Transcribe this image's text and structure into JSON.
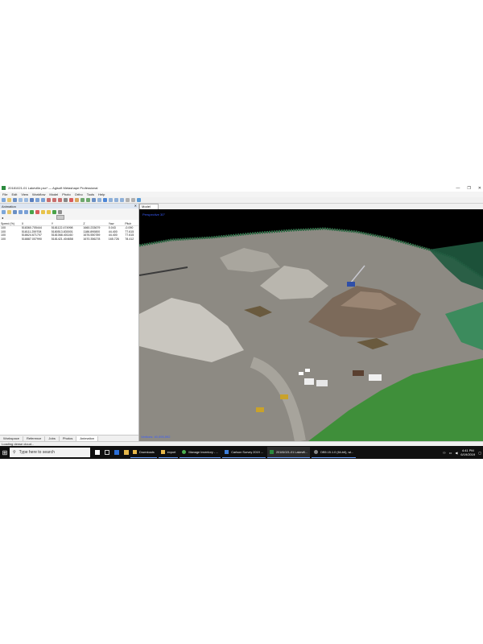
{
  "window": {
    "title": "20181021-01 Lakeville.psx* — Agisoft Metashape Professional",
    "controls": [
      "—",
      "❐",
      "✕"
    ]
  },
  "menu": [
    "File",
    "Edit",
    "View",
    "Workflow",
    "Model",
    "Photo",
    "Ortho",
    "Tools",
    "Help"
  ],
  "left_panel": {
    "title": "Animation",
    "columns": [
      "Speed (%)",
      "X",
      "Y",
      "Z",
      "Yaw",
      "Pitch"
    ],
    "rows": [
      [
        "100",
        "518360.705444",
        "5181122.474998",
        "1660.233679",
        "0.043",
        "-0.090"
      ],
      [
        "100",
        "518111.259708",
        "5180513.830001",
        "1186.890800",
        "44.400",
        "77.615"
      ],
      [
        "100",
        "518624.671707",
        "5181068.401160",
        "1676.550789",
        "44.400",
        "77.615"
      ],
      [
        "100",
        "518887.007990",
        "5181421.404658",
        "1670.356278",
        "165.726",
        "78.412"
      ]
    ],
    "tabs": [
      "Workspace",
      "Reference",
      "Jobs",
      "Photos",
      "Animation"
    ],
    "active_tab": "Animation"
  },
  "model_panel": {
    "tab": "Model",
    "overlay_top": "Perspective 30°",
    "overlay_bottom": "Vertices: 40,095,592"
  },
  "status": "Loading dense cloud...",
  "taskbar": {
    "search_placeholder": "Type here to search",
    "items": [
      {
        "label": "Downloads",
        "color": "#e8b84a"
      },
      {
        "label": "export",
        "color": "#e8b84a"
      },
      {
        "label": "Manage Inventory - ...",
        "color": "#4caf50"
      },
      {
        "label": "Carlson Survey 2019 ...",
        "color": "#3f7fd8"
      },
      {
        "label": "20181021-01 Lakevill...",
        "color": "#2b8a3e"
      },
      {
        "label": "DB5.15.1.0 (64-bit), wi...",
        "color": "#888888"
      }
    ],
    "clock_time": "4:41 PM",
    "clock_date": "6/19/2019"
  },
  "colors": {
    "accent": "#3a5cff",
    "taskbar": "#101010",
    "panel_header": "#dde6f1"
  }
}
